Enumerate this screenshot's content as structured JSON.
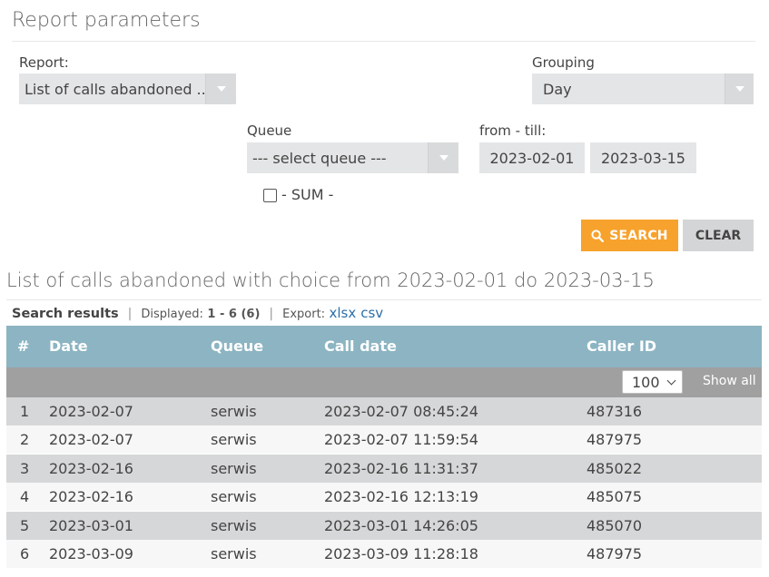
{
  "page": {
    "title": "Report parameters"
  },
  "filters": {
    "report_label": "Report:",
    "report_value": "List of calls abandoned ...",
    "grouping_label": "Grouping",
    "grouping_value": "Day",
    "queue_label": "Queue",
    "queue_value": "--- select queue ---",
    "range_label": "from - till:",
    "date_from": "2023-02-01",
    "date_till": "2023-03-15",
    "sum_label": "- SUM -",
    "sum_checked": false
  },
  "buttons": {
    "search_label": "SEARCH",
    "clear_label": "CLEAR"
  },
  "results": {
    "title": "List of calls abandoned with choice from 2023-02-01 do 2023-03-15",
    "search_results_label": "Search results",
    "separator": "|",
    "displayed_label": "Displayed:",
    "displayed_value": "1 - 6 (6)",
    "export_label": "Export:",
    "export_xlsx": "xlsx",
    "export_csv": "csv"
  },
  "table": {
    "columns": [
      "#",
      "Date",
      "Queue",
      "Call date",
      "Caller ID"
    ],
    "page_size": "100",
    "show_all_label": "Show all",
    "rows": [
      [
        "1",
        "2023-02-07",
        "serwis",
        "2023-02-07 08:45:24",
        "487316"
      ],
      [
        "2",
        "2023-02-07",
        "serwis",
        "2023-02-07 11:59:54",
        "487975"
      ],
      [
        "3",
        "2023-02-16",
        "serwis",
        "2023-02-16 11:31:37",
        "485022"
      ],
      [
        "4",
        "2023-02-16",
        "serwis",
        "2023-02-16 12:13:19",
        "485075"
      ],
      [
        "5",
        "2023-03-01",
        "serwis",
        "2023-03-01 14:26:05",
        "485070"
      ],
      [
        "6",
        "2023-03-09",
        "serwis",
        "2023-03-09 11:28:18",
        "487975"
      ]
    ]
  },
  "colors": {
    "accent": "#f7a22c",
    "table_header": "#8cb4c2",
    "link": "#2b6ea9"
  }
}
